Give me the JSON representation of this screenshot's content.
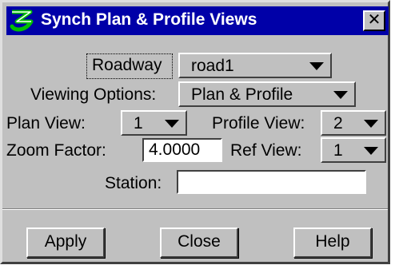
{
  "window": {
    "title": "Synch Plan & Profile Views",
    "close_symbol": "✕",
    "app_icon": "geopak-logo-icon"
  },
  "form": {
    "roadway": {
      "label": "Roadway",
      "value": "road1"
    },
    "viewing_options": {
      "label": "Viewing Options:",
      "value": "Plan & Profile"
    },
    "plan_view": {
      "label": "Plan View:",
      "value": "1"
    },
    "profile_view": {
      "label": "Profile View:",
      "value": "2"
    },
    "zoom_factor": {
      "label": "Zoom Factor:",
      "value": "4.0000"
    },
    "ref_view": {
      "label": "Ref View:",
      "value": "1"
    },
    "station": {
      "label": "Station:",
      "value": ""
    }
  },
  "buttons": {
    "apply": "Apply",
    "close": "Close",
    "help": "Help"
  },
  "colors": {
    "titlebar": "#0000a8",
    "face": "#c0c0c0",
    "logo": "#00c000"
  }
}
